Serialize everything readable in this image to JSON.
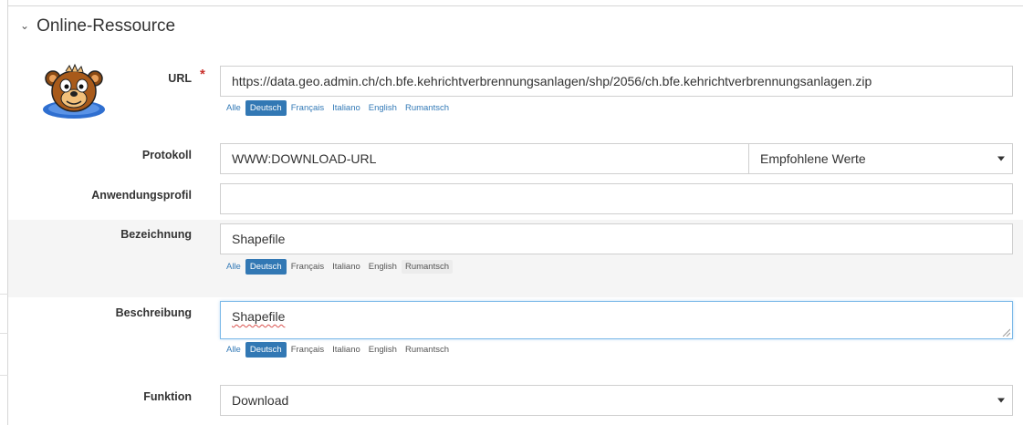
{
  "section": {
    "title": "Online-Ressource"
  },
  "languages": [
    "Alle",
    "Deutsch",
    "Français",
    "Italiano",
    "English",
    "Rumantsch"
  ],
  "fields": {
    "url": {
      "label": "URL",
      "value": "https://data.geo.admin.ch/ch.bfe.kehrichtverbrennungsanlagen/shp/2056/ch.bfe.kehrichtverbrennungsanlagen.zip"
    },
    "protokoll": {
      "label": "Protokoll",
      "value": "WWW:DOWNLOAD-URL",
      "select_value": "Empfohlene Werte"
    },
    "anwendungsprofil": {
      "label": "Anwendungsprofil",
      "value": ""
    },
    "bezeichnung": {
      "label": "Bezeichnung",
      "value": "Shapefile"
    },
    "beschreibung": {
      "label": "Beschreibung",
      "value": "Shapefile"
    },
    "funktion": {
      "label": "Funktion",
      "value": "Download"
    }
  },
  "colors": {
    "accent": "#3278b4",
    "required": "#c9302c",
    "link": "#337ab7"
  }
}
